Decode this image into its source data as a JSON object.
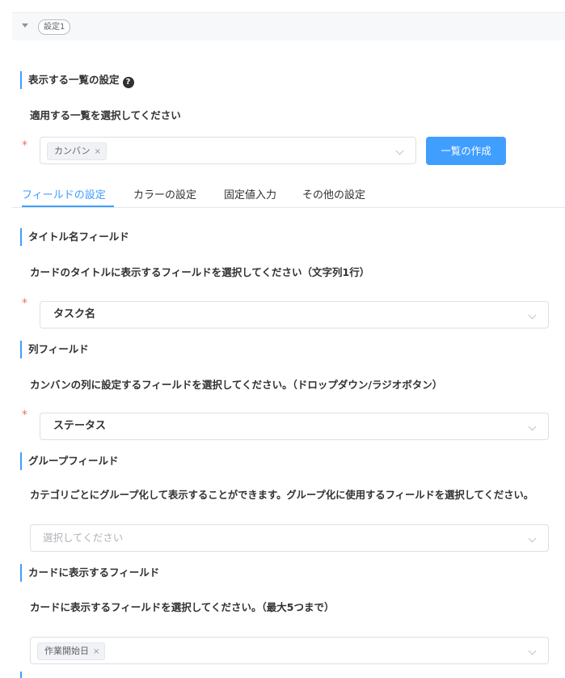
{
  "header": {
    "label": "設定1"
  },
  "list_section": {
    "title": "表示する一覧の設定",
    "help_icon": "?",
    "description": "適用する一覧を選択してください",
    "required_mark": "*",
    "selected_tag": "カンバン",
    "tag_remove": "×",
    "create_button": "一覧の作成"
  },
  "tabs": [
    {
      "label": "フィールドの設定",
      "active": true
    },
    {
      "label": "カラーの設定",
      "active": false
    },
    {
      "label": "固定値入力",
      "active": false
    },
    {
      "label": "その他の設定",
      "active": false
    }
  ],
  "title_field": {
    "title": "タイトル名フィールド",
    "description": "カードのタイトルに表示するフィールドを選択してください（文字列1行）",
    "required_mark": "*",
    "value": "タスク名"
  },
  "column_field": {
    "title": "列フィールド",
    "description": "カンバンの列に設定するフィールドを選択してください。（ドロップダウン/ラジオボタン）",
    "required_mark": "*",
    "value": "ステータス"
  },
  "group_field": {
    "title": "グループフィールド",
    "description": "カテゴリごとにグループ化して表示することができます。グループ化に使用するフィールドを選択してください。",
    "placeholder": "選択してください"
  },
  "card_fields": {
    "title": "カードに表示するフィールド",
    "description": "カードに表示するフィールドを選択してください。（最大5つまで）",
    "selected_tag": "作業開始日",
    "tag_remove": "×"
  },
  "colors": {
    "accent": "#409eff",
    "required": "#f56c6c"
  }
}
